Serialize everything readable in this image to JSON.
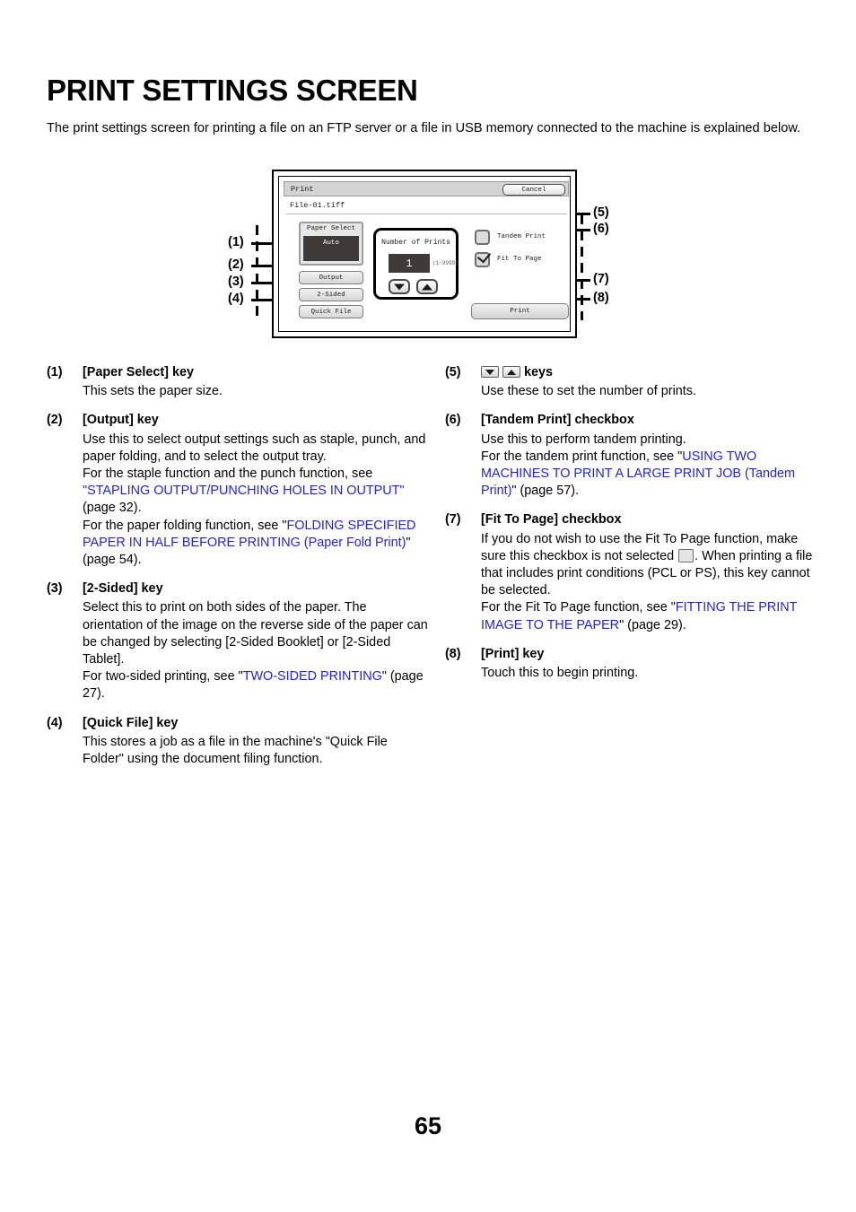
{
  "page": {
    "title": "PRINT SETTINGS SCREEN",
    "intro": "The print settings screen for printing a file on an FTP server or a file in USB memory connected to the machine is explained below.",
    "page_number": "65"
  },
  "figure": {
    "screen": {
      "titlebar_label": "Print",
      "cancel_label": "Cancel",
      "file_name": "File-01.tiff",
      "paper_select": {
        "label": "Paper Select",
        "value": "Auto"
      },
      "output_label": "Output",
      "two_sided_label": "2-Sided",
      "quick_file_label": "Quick File",
      "number_of_prints": {
        "title": "Number of Prints",
        "value": "1",
        "range": "(1~9999)",
        "down_icon": "triangle-down-icon",
        "up_icon": "triangle-up-icon"
      },
      "tandem_print": {
        "label": "Tandem Print",
        "checked": false
      },
      "fit_to_page": {
        "label": "Fit To Page",
        "checked": true
      },
      "print_label": "Print"
    },
    "callouts": {
      "c1": "(1)",
      "c2": "(2)",
      "c3": "(3)",
      "c4": "(4)",
      "c5": "(5)",
      "c6": "(6)",
      "c7": "(7)",
      "c8": "(8)"
    }
  },
  "items": {
    "left": [
      {
        "num": "(1)",
        "title": "[Paper Select] key",
        "body_1": "This sets the paper size."
      },
      {
        "num": "(2)",
        "title": "[Output] key",
        "body_1": "Use this to select output settings such as staple, punch, and paper folding, and to select the output tray.",
        "body_2": "For the staple function and the punch function, see ",
        "link_1": "\"STAPLING OUTPUT/PUNCHING HOLES IN OUTPUT\"",
        "body_3": " (page 32).",
        "body_4": "For the paper folding function, see \"",
        "link_2": "FOLDING SPECIFIED PAPER IN HALF BEFORE PRINTING (Paper Fold Print)",
        "body_5": "\" (page 54)."
      },
      {
        "num": "(3)",
        "title": "[2-Sided] key",
        "body_1": "Select this to print on both sides of the paper. The orientation of the image on the reverse side of the paper can be changed by selecting [2-Sided Booklet] or [2-Sided Tablet].",
        "body_2": "For two-sided printing, see \"",
        "link_1": "TWO-SIDED PRINTING",
        "body_3": "\" (page 27)."
      },
      {
        "num": "(4)",
        "title": "[Quick File] key",
        "body_1": "This stores a job as a file in the machine's \"Quick File Folder\" using the document filing function."
      }
    ],
    "right": [
      {
        "num": "(5)",
        "title": "keys",
        "icon_down": "triangle-down-key-icon",
        "icon_up": "triangle-up-key-icon",
        "body_1": "Use these to set the number of prints."
      },
      {
        "num": "(6)",
        "title": "[Tandem Print] checkbox",
        "body_1": "Use this to perform tandem printing.",
        "body_2": "For the tandem print function, see \"",
        "link_1": "USING TWO MACHINES TO PRINT A LARGE PRINT JOB (Tandem Print)",
        "body_3": "\" (page 57)."
      },
      {
        "num": "(7)",
        "title": "[Fit To Page] checkbox",
        "body_1a": "If you do not wish to use the Fit To Page function, make sure this checkbox is not selected ",
        "body_1b": ". When printing a file that includes print conditions (PCL or PS), this key cannot be selected.",
        "body_2": "For the Fit To Page function, see \"",
        "link_1": "FITTING THE PRINT IMAGE TO THE PAPER",
        "body_3": "\" (page 29)."
      },
      {
        "num": "(8)",
        "title": "[Print] key",
        "body_1": "Touch this to begin printing."
      }
    ]
  }
}
